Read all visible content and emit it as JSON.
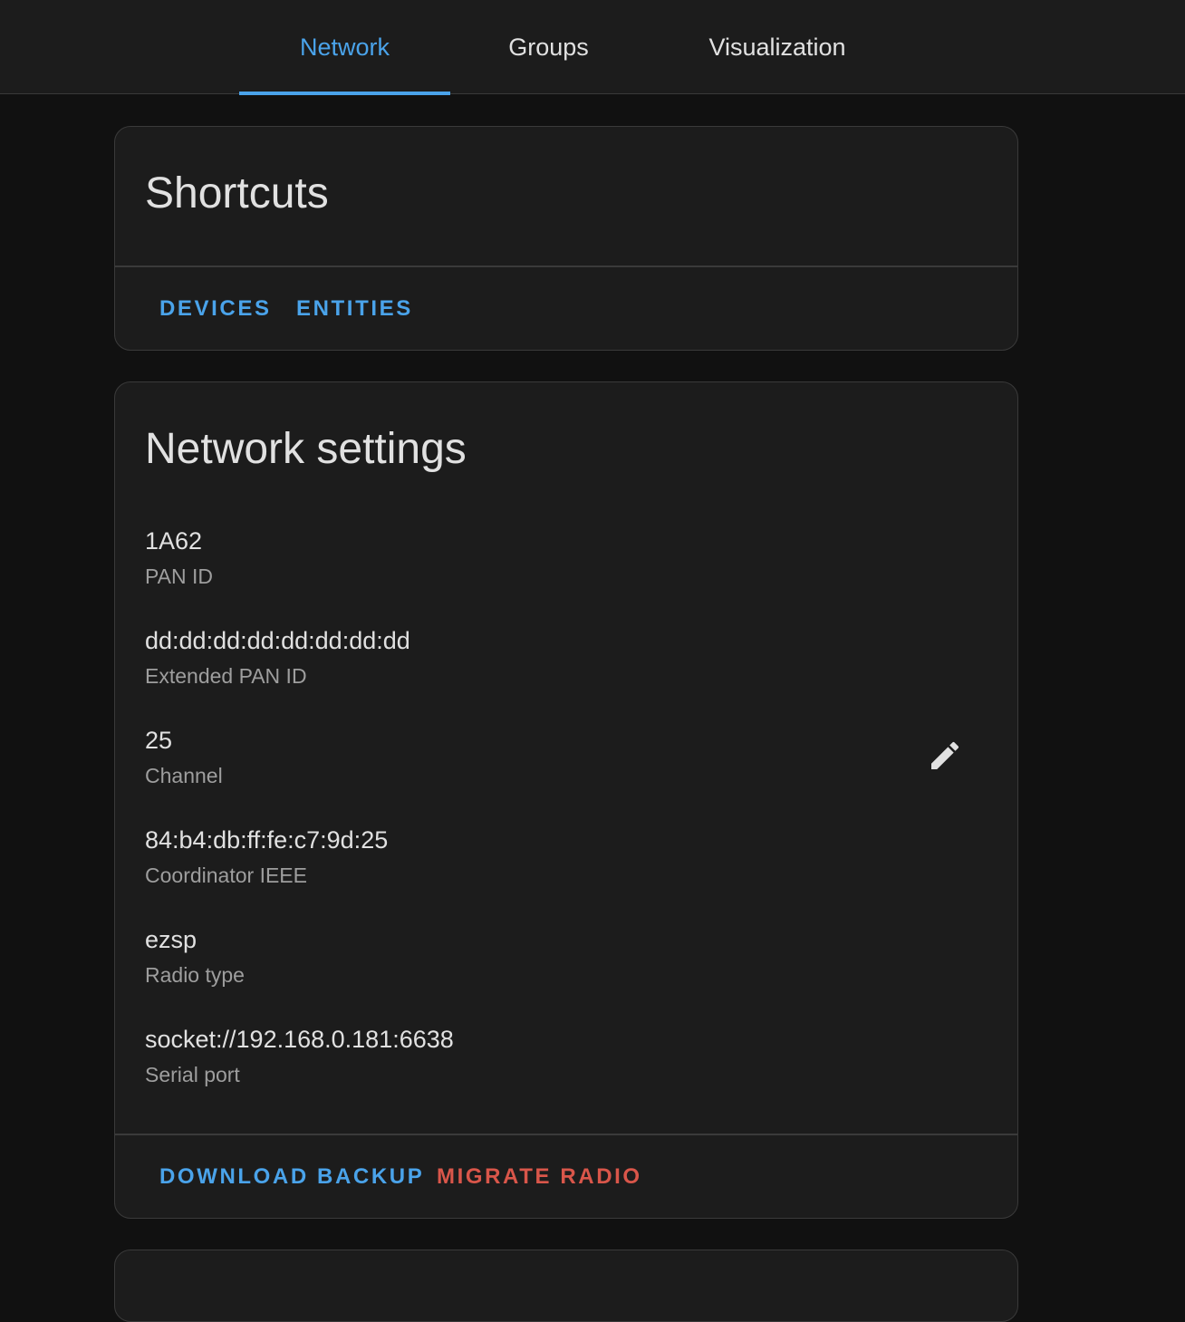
{
  "tabs": [
    {
      "label": "Network",
      "active": true
    },
    {
      "label": "Groups",
      "active": false
    },
    {
      "label": "Visualization",
      "active": false
    }
  ],
  "shortcuts": {
    "title": "Shortcuts",
    "devices_label": "DEVICES",
    "entities_label": "ENTITIES"
  },
  "network_settings": {
    "title": "Network settings",
    "items": [
      {
        "value": "1A62",
        "label": "PAN ID"
      },
      {
        "value": "dd:dd:dd:dd:dd:dd:dd:dd",
        "label": "Extended PAN ID"
      },
      {
        "value": "25",
        "label": "Channel"
      },
      {
        "value": "84:b4:db:ff:fe:c7:9d:25",
        "label": "Coordinator IEEE"
      },
      {
        "value": "ezsp",
        "label": "Radio type"
      },
      {
        "value": "socket://192.168.0.181:6638",
        "label": "Serial port"
      }
    ],
    "edit_icon": "pencil-icon",
    "download_backup_label": "DOWNLOAD BACKUP",
    "migrate_radio_label": "MIGRATE RADIO"
  },
  "colors": {
    "accent": "#4aa3ea",
    "warning": "#d9564a",
    "card_bg": "#1c1c1c",
    "page_bg": "#111111"
  }
}
